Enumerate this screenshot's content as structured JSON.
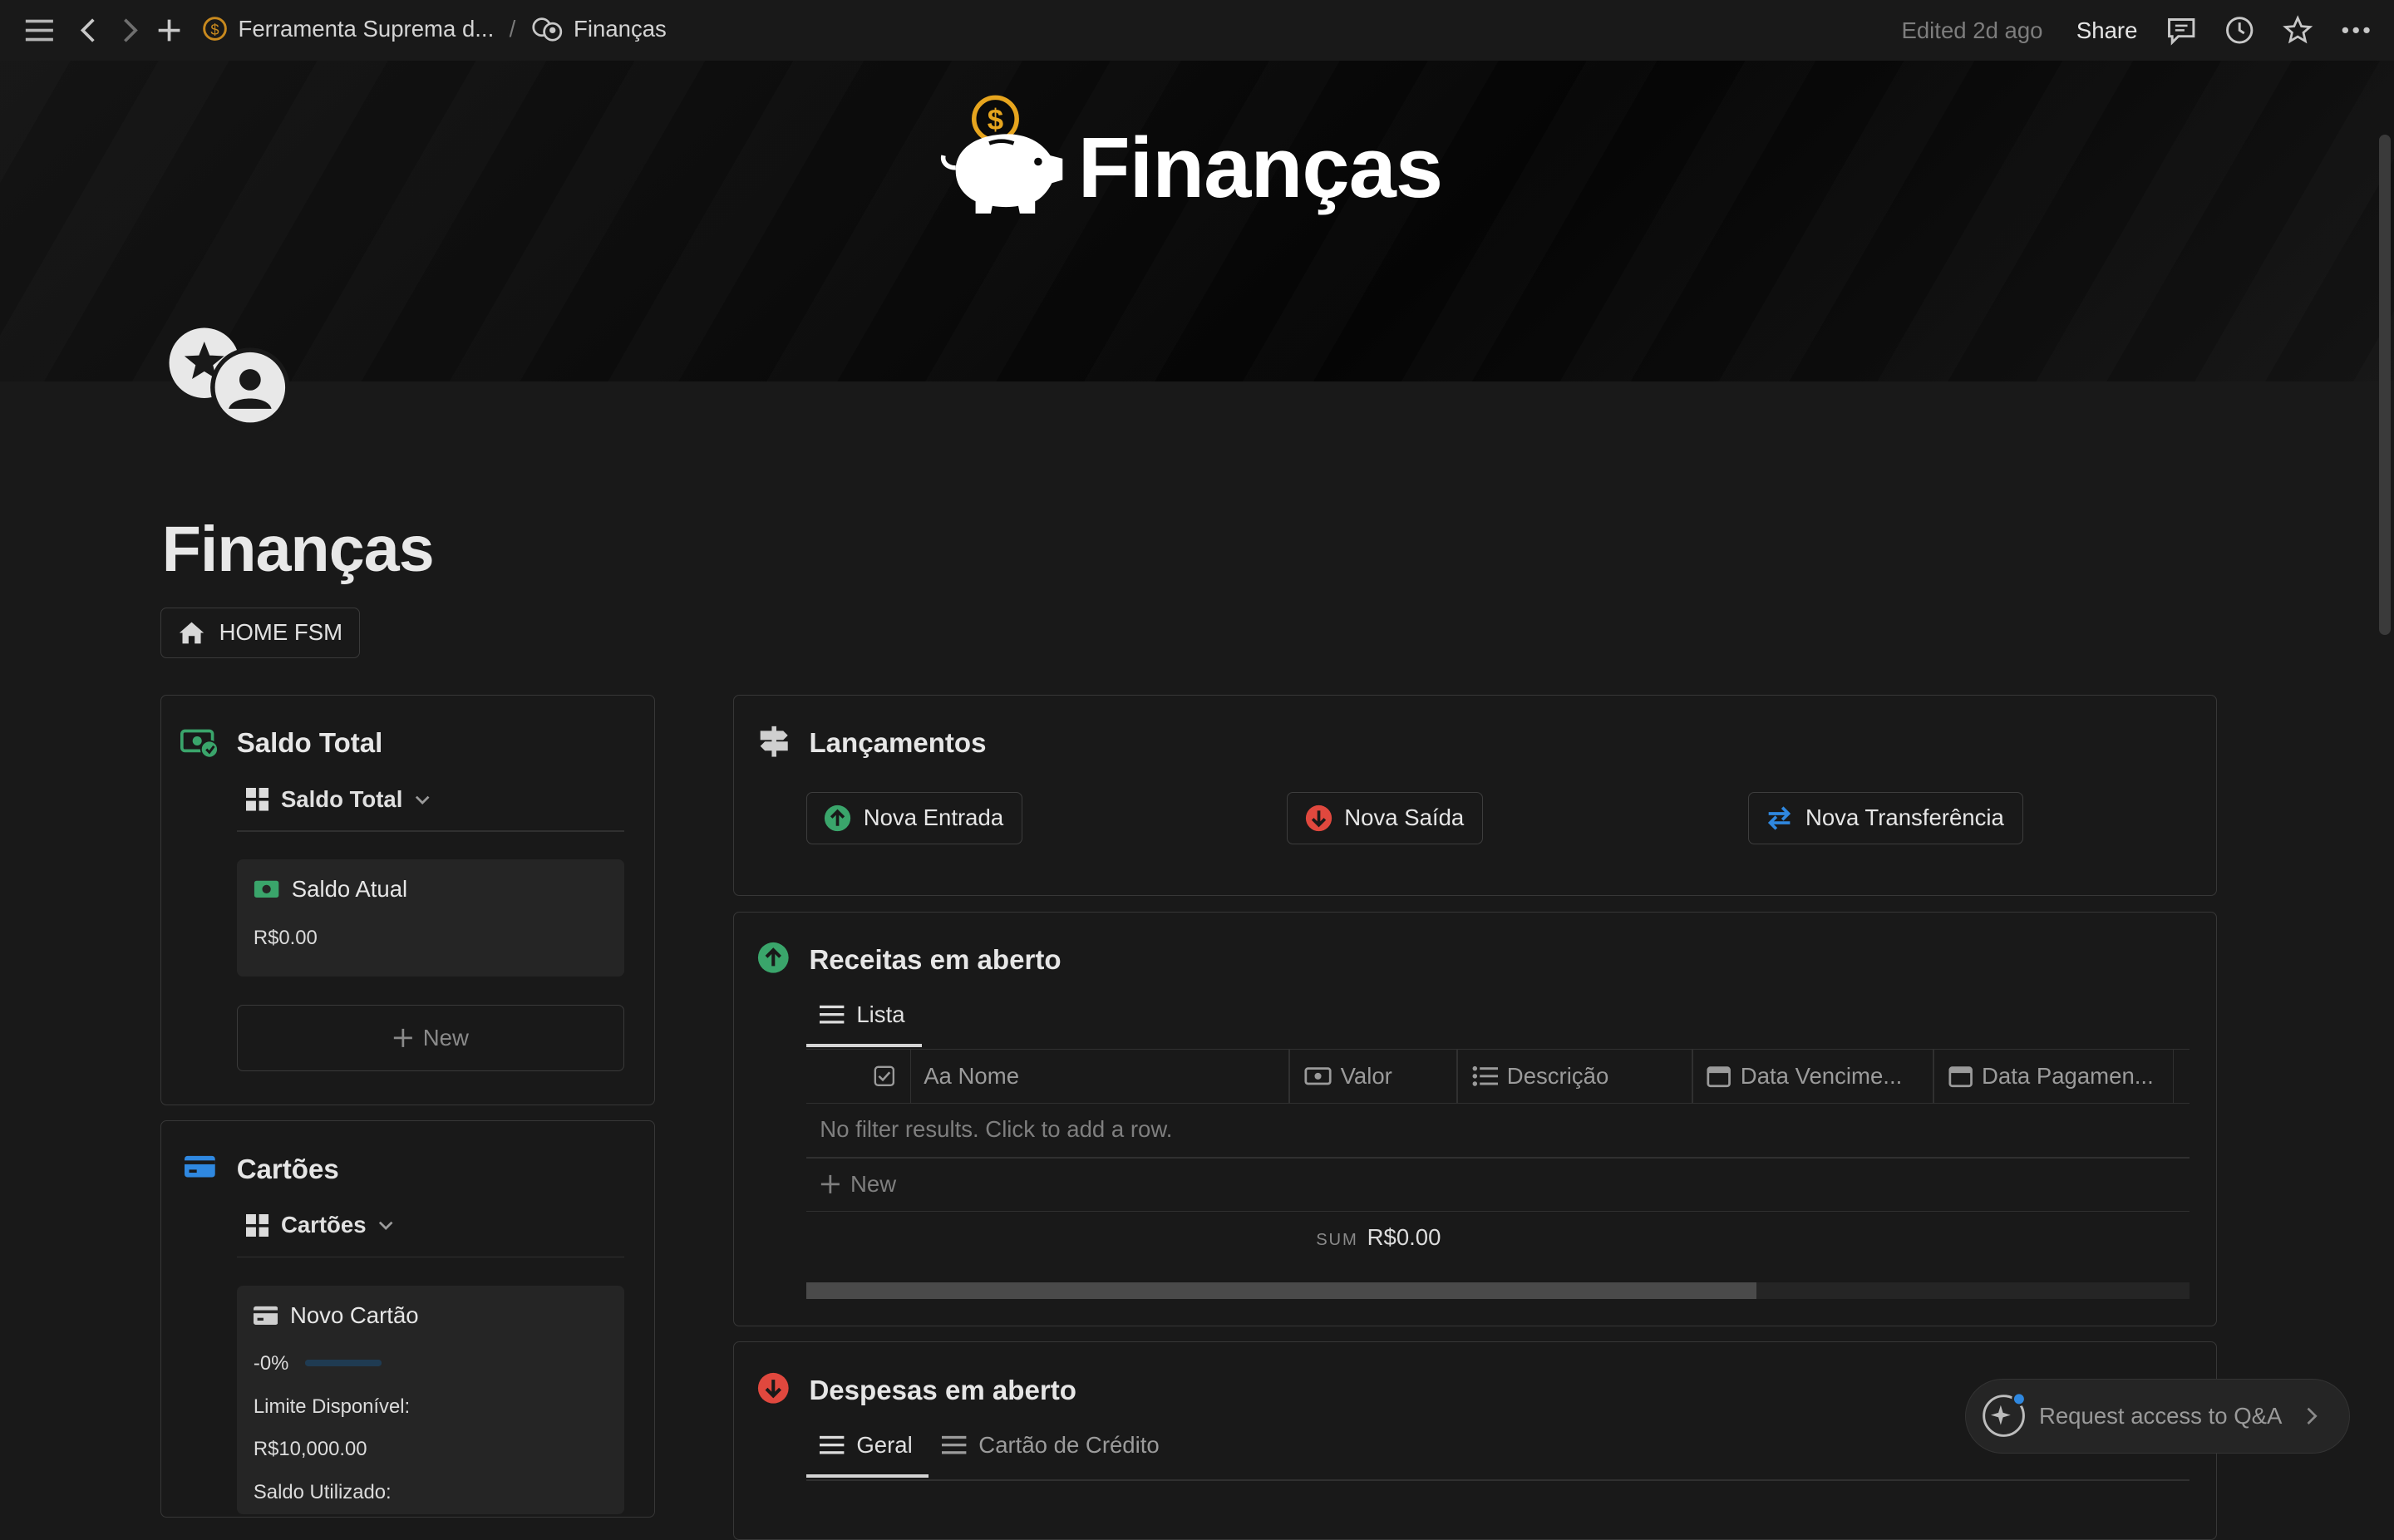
{
  "topbar": {
    "breadcrumb_parent": "Ferramenta Suprema d...",
    "breadcrumb_sep": "/",
    "breadcrumb_current": "Finanças",
    "edited": "Edited 2d ago",
    "share": "Share"
  },
  "cover": {
    "title": "Finanças"
  },
  "page": {
    "title": "Finanças",
    "home_button": "HOME FSM"
  },
  "saldo": {
    "title": "Saldo Total",
    "view": "Saldo Total",
    "card_title": "Saldo Atual",
    "card_value": "R$0.00",
    "new_label": "New"
  },
  "cartoes": {
    "title": "Cartões",
    "view": "Cartões",
    "card_title": "Novo Cartão",
    "percent": "-0%",
    "percent_value": 0,
    "limite_label": "Limite Disponível:",
    "limite_value": "R$10,000.00",
    "saldo_label": "Saldo Utilizado:"
  },
  "lancamentos": {
    "title": "Lançamentos",
    "buttons": [
      "Nova Entrada",
      "Nova Saída",
      "Nova Transferência"
    ]
  },
  "receitas": {
    "title": "Receitas em aberto",
    "tab": "Lista",
    "columns": [
      "Aa Nome",
      "Valor",
      "Descrição",
      "Data Vencime...",
      "Data Pagamen..."
    ],
    "empty": "No filter results. Click to add a row.",
    "new_label": "New",
    "sum_label": "SUM",
    "sum_value": "R$0.00",
    "scroll_fraction": 0.687
  },
  "despesas": {
    "title": "Despesas em aberto",
    "tabs": [
      "Geral",
      "Cartão de Crédito"
    ]
  },
  "qa": {
    "label": "Request access to Q&A"
  },
  "colors": {
    "green": "#3aa56b",
    "red": "#e0483e",
    "blue": "#2f88e0",
    "gold": "#e7a51e"
  }
}
